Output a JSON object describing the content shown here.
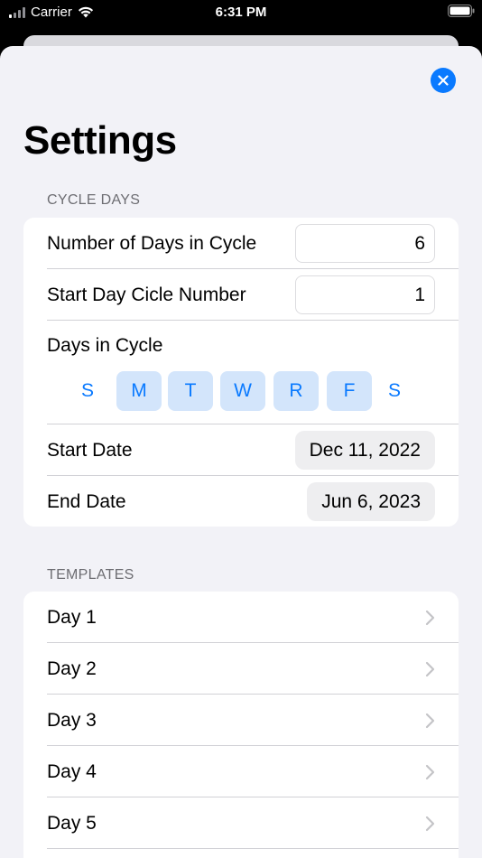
{
  "status_bar": {
    "carrier": "Carrier",
    "time": "6:31 PM"
  },
  "page": {
    "title": "Settings"
  },
  "cycle_days": {
    "header": "CYCLE DAYS",
    "num_days_label": "Number of Days in Cycle",
    "num_days_value": "6",
    "start_day_label": "Start Day Cicle Number",
    "start_day_value": "1",
    "days_label": "Days in Cycle",
    "days": [
      {
        "letter": "S",
        "selected": false
      },
      {
        "letter": "M",
        "selected": true
      },
      {
        "letter": "T",
        "selected": true
      },
      {
        "letter": "W",
        "selected": true
      },
      {
        "letter": "R",
        "selected": true
      },
      {
        "letter": "F",
        "selected": true
      },
      {
        "letter": "S",
        "selected": false
      }
    ],
    "start_date_label": "Start Date",
    "start_date_value": "Dec 11, 2022",
    "end_date_label": "End Date",
    "end_date_value": "Jun 6, 2023"
  },
  "templates": {
    "header": "TEMPLATES",
    "items": [
      {
        "label": "Day 1"
      },
      {
        "label": "Day 2"
      },
      {
        "label": "Day 3"
      },
      {
        "label": "Day 4"
      },
      {
        "label": "Day 5"
      }
    ]
  },
  "colors": {
    "accent": "#0a7aff",
    "selected_day_bg": "#d3e5fb",
    "sheet_bg": "#f2f2f7"
  }
}
